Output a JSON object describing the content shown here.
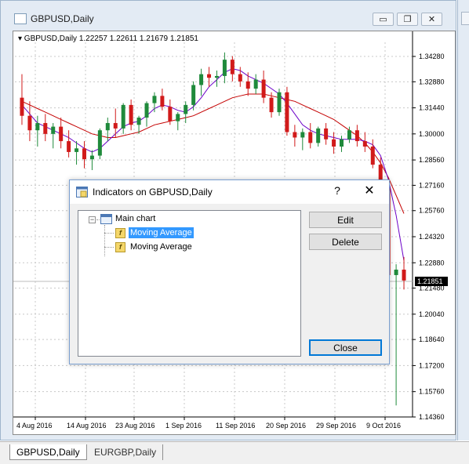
{
  "window": {
    "title": "GBPUSD,Daily",
    "minimize_glyph": "▭",
    "restore_glyph": "❐",
    "close_glyph": "✕"
  },
  "chart": {
    "info_line": "▾ GBPUSD,Daily  1.22257 1.22611 1.21679 1.21851",
    "current_price": "1.21851",
    "colors": {
      "bull": "#1f8a3b",
      "bear": "#d11a1a",
      "ma_fast": "#6b00c8",
      "ma_slow": "#c40000",
      "grid": "#c8c8c8"
    }
  },
  "chart_data": {
    "type": "line",
    "title": "GBPUSD,Daily",
    "y_ticks": [
      "1.34280",
      "1.32880",
      "1.31440",
      "1.30000",
      "1.28560",
      "1.27160",
      "1.25760",
      "1.24320",
      "1.22880",
      "1.21480",
      "1.20040",
      "1.18640",
      "1.17200",
      "1.15760",
      "1.14360"
    ],
    "x_ticks": [
      "4 Aug 2016",
      "14 Aug 2016",
      "23 Aug 2016",
      "1 Sep 2016",
      "11 Sep 2016",
      "20 Sep 2016",
      "29 Sep 2016",
      "9 Oct 2016"
    ],
    "ylim": [
      1.1436,
      1.346
    ],
    "current_price": 1.21851,
    "candles": [
      [
        1.32,
        1.333,
        1.305,
        1.31
      ],
      [
        1.31,
        1.318,
        1.296,
        1.302
      ],
      [
        1.302,
        1.31,
        1.293,
        1.306
      ],
      [
        1.306,
        1.311,
        1.296,
        1.3
      ],
      [
        1.3,
        1.306,
        1.292,
        1.304
      ],
      [
        1.304,
        1.309,
        1.292,
        1.296
      ],
      [
        1.296,
        1.302,
        1.287,
        1.29
      ],
      [
        1.29,
        1.296,
        1.283,
        1.292
      ],
      [
        1.292,
        1.296,
        1.281,
        1.286
      ],
      [
        1.286,
        1.291,
        1.28,
        1.288
      ],
      [
        1.288,
        1.303,
        1.286,
        1.302
      ],
      [
        1.302,
        1.309,
        1.296,
        1.306
      ],
      [
        1.306,
        1.314,
        1.298,
        1.303
      ],
      [
        1.303,
        1.317,
        1.3,
        1.316
      ],
      [
        1.316,
        1.319,
        1.302,
        1.305
      ],
      [
        1.305,
        1.31,
        1.3,
        1.309
      ],
      [
        1.309,
        1.318,
        1.304,
        1.317
      ],
      [
        1.317,
        1.323,
        1.312,
        1.321
      ],
      [
        1.321,
        1.325,
        1.313,
        1.315
      ],
      [
        1.315,
        1.319,
        1.305,
        1.307
      ],
      [
        1.307,
        1.312,
        1.302,
        1.311
      ],
      [
        1.311,
        1.318,
        1.306,
        1.316
      ],
      [
        1.316,
        1.329,
        1.313,
        1.327
      ],
      [
        1.327,
        1.336,
        1.321,
        1.333
      ],
      [
        1.333,
        1.337,
        1.326,
        1.331
      ],
      [
        1.331,
        1.335,
        1.326,
        1.332
      ],
      [
        1.332,
        1.345,
        1.328,
        1.341
      ],
      [
        1.341,
        1.343,
        1.329,
        1.333
      ],
      [
        1.333,
        1.337,
        1.326,
        1.329
      ],
      [
        1.329,
        1.334,
        1.321,
        1.325
      ],
      [
        1.325,
        1.333,
        1.322,
        1.33
      ],
      [
        1.33,
        1.335,
        1.317,
        1.32
      ],
      [
        1.32,
        1.323,
        1.309,
        1.312
      ],
      [
        1.312,
        1.325,
        1.31,
        1.323
      ],
      [
        1.323,
        1.326,
        1.299,
        1.301
      ],
      [
        1.301,
        1.305,
        1.293,
        1.298
      ],
      [
        1.298,
        1.303,
        1.291,
        1.301
      ],
      [
        1.301,
        1.306,
        1.292,
        1.295
      ],
      [
        1.295,
        1.304,
        1.293,
        1.303
      ],
      [
        1.303,
        1.306,
        1.294,
        1.297
      ],
      [
        1.297,
        1.301,
        1.289,
        1.293
      ],
      [
        1.293,
        1.299,
        1.29,
        1.297
      ],
      [
        1.297,
        1.304,
        1.295,
        1.302
      ],
      [
        1.302,
        1.305,
        1.293,
        1.296
      ],
      [
        1.296,
        1.301,
        1.29,
        1.293
      ],
      [
        1.293,
        1.297,
        1.281,
        1.283
      ],
      [
        1.283,
        1.287,
        1.265,
        1.27
      ],
      [
        1.27,
        1.275,
        1.218,
        1.222
      ],
      [
        1.222,
        1.228,
        1.15,
        1.225
      ],
      [
        1.225,
        1.232,
        1.214,
        1.219
      ]
    ],
    "ma_fast": [
      1.316,
      1.311,
      1.306,
      1.304,
      1.302,
      1.3,
      1.298,
      1.295,
      1.292,
      1.29,
      1.292,
      1.296,
      1.3,
      1.304,
      1.306,
      1.307,
      1.31,
      1.314,
      1.316,
      1.315,
      1.313,
      1.312,
      1.315,
      1.32,
      1.326,
      1.33,
      1.334,
      1.336,
      1.335,
      1.332,
      1.33,
      1.328,
      1.325,
      1.322,
      1.317,
      1.311,
      1.305,
      1.302,
      1.3,
      1.299,
      1.298,
      1.297,
      1.297,
      1.297,
      1.296,
      1.294,
      1.288,
      1.275,
      1.255,
      1.23
    ],
    "ma_slow": [
      1.318,
      1.316,
      1.314,
      1.312,
      1.31,
      1.308,
      1.306,
      1.304,
      1.302,
      1.3,
      1.299,
      1.298,
      1.298,
      1.299,
      1.3,
      1.301,
      1.303,
      1.305,
      1.306,
      1.307,
      1.308,
      1.309,
      1.31,
      1.312,
      1.314,
      1.316,
      1.318,
      1.32,
      1.321,
      1.322,
      1.322,
      1.322,
      1.321,
      1.32,
      1.319,
      1.318,
      1.316,
      1.314,
      1.312,
      1.31,
      1.308,
      1.305,
      1.302,
      1.299,
      1.295,
      1.29,
      1.284,
      1.276,
      1.266,
      1.256
    ]
  },
  "dialog": {
    "title": "Indicators on GBPUSD,Daily",
    "help_glyph": "?",
    "close_glyph": "✕",
    "tree": {
      "expander_glyph": "−",
      "root_label": "Main chart",
      "items": [
        {
          "label": "Moving Average",
          "selected": true
        },
        {
          "label": "Moving Average",
          "selected": false
        }
      ],
      "fx_glyph": "f"
    },
    "buttons": {
      "edit": "Edit",
      "delete": "Delete",
      "close": "Close"
    }
  },
  "tabs": [
    {
      "label": "GBPUSD,Daily",
      "active": true
    },
    {
      "label": "EURGBP,Daily",
      "active": false
    }
  ]
}
